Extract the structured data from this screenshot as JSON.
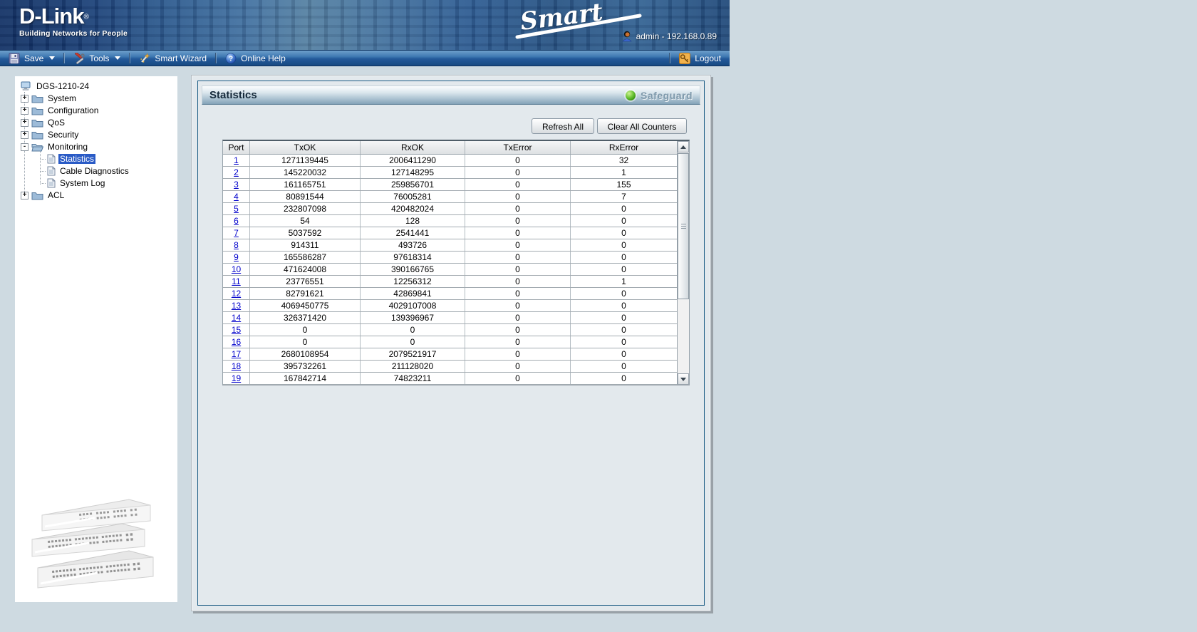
{
  "banner": {
    "logo_title": "D-Link",
    "logo_registered": "®",
    "logo_tagline": "Building Networks for People",
    "smart_logo": "Smart",
    "user_label": "admin - 192.168.0.89"
  },
  "toolbar": {
    "save_label": "Save",
    "tools_label": "Tools",
    "smart_wizard_label": "Smart Wizard",
    "online_help_label": "Online Help",
    "logout_label": "Logout"
  },
  "sidebar": {
    "root_label": "DGS-1210-24",
    "nodes": [
      {
        "label": "System",
        "expand": "+"
      },
      {
        "label": "Configuration",
        "expand": "+"
      },
      {
        "label": "QoS",
        "expand": "+"
      },
      {
        "label": "Security",
        "expand": "+"
      },
      {
        "label": "Monitoring",
        "expand": "-",
        "children": [
          {
            "label": "Statistics",
            "selected": true
          },
          {
            "label": "Cable Diagnostics",
            "selected": false
          },
          {
            "label": "System Log",
            "selected": false
          }
        ]
      },
      {
        "label": "ACL",
        "expand": "+"
      }
    ]
  },
  "main": {
    "title": "Statistics",
    "safeguard_label": "Safeguard",
    "refresh_button": "Refresh All",
    "clear_button": "Clear All Counters"
  },
  "stats_table": {
    "columns": [
      "Port",
      "TxOK",
      "RxOK",
      "TxError",
      "RxError"
    ],
    "rows": [
      [
        "1",
        "1271139445",
        "2006411290",
        "0",
        "32"
      ],
      [
        "2",
        "145220032",
        "127148295",
        "0",
        "1"
      ],
      [
        "3",
        "161165751",
        "259856701",
        "0",
        "155"
      ],
      [
        "4",
        "80891544",
        "76005281",
        "0",
        "7"
      ],
      [
        "5",
        "232807098",
        "420482024",
        "0",
        "0"
      ],
      [
        "6",
        "54",
        "128",
        "0",
        "0"
      ],
      [
        "7",
        "5037592",
        "2541441",
        "0",
        "0"
      ],
      [
        "8",
        "914311",
        "493726",
        "0",
        "0"
      ],
      [
        "9",
        "165586287",
        "97618314",
        "0",
        "0"
      ],
      [
        "10",
        "471624008",
        "390166765",
        "0",
        "0"
      ],
      [
        "11",
        "23776551",
        "12256312",
        "0",
        "1"
      ],
      [
        "12",
        "82791621",
        "42869841",
        "0",
        "0"
      ],
      [
        "13",
        "4069450775",
        "4029107008",
        "0",
        "0"
      ],
      [
        "14",
        "326371420",
        "139396967",
        "0",
        "0"
      ],
      [
        "15",
        "0",
        "0",
        "0",
        "0"
      ],
      [
        "16",
        "0",
        "0",
        "0",
        "0"
      ],
      [
        "17",
        "2680108954",
        "2079521917",
        "0",
        "0"
      ],
      [
        "18",
        "395732261",
        "211128020",
        "0",
        "0"
      ],
      [
        "19",
        "167842714",
        "74823211",
        "0",
        "0"
      ]
    ]
  },
  "colors": {
    "page_bg": "#CEDAE1",
    "selection_blue": "#2A5BC6",
    "link_blue": "#0000CC",
    "safeguard_green": "#49A31F",
    "toolbar_blue": "#2F6AA6"
  }
}
